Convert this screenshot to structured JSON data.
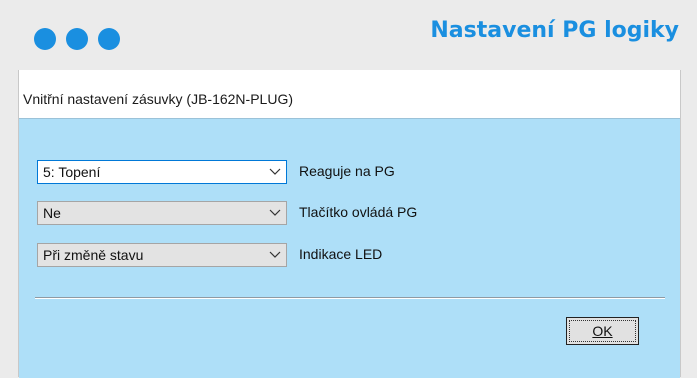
{
  "header": {
    "title": "Nastavení PG logiky",
    "dots": [
      "window-dot-1",
      "window-dot-2",
      "window-dot-3"
    ],
    "accent_color": "#1a8fe0"
  },
  "dialog": {
    "title": "Vnitřní nastavení zásuvky (JB-162N-PLUG)",
    "background_color": "#aedff8",
    "rows": [
      {
        "value": "5: Topení",
        "label": "Reaguje na PG"
      },
      {
        "value": "Ne",
        "label": "Tlačítko ovládá PG"
      },
      {
        "value": "Při změně stavu",
        "label": "Indikace LED"
      }
    ],
    "ok_label": "OK"
  }
}
